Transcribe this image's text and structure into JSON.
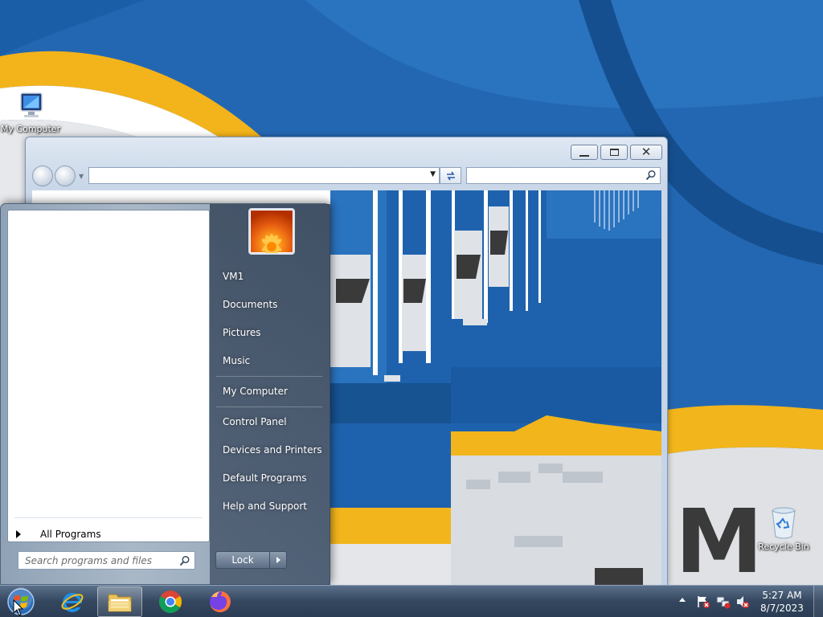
{
  "desktop": {
    "icons": [
      {
        "label": "My Computer",
        "icon": "computer-monitor-icon"
      },
      {
        "label": "Recycle Bin",
        "icon": "recycle-bin-icon"
      }
    ]
  },
  "explorer": {
    "address_value": "",
    "search_placeholder": ""
  },
  "start_menu": {
    "all_programs_label": "All Programs",
    "search_placeholder": "Search programs and files",
    "user_picture": "flower-user-picture",
    "right_items": [
      "VM1",
      "Documents",
      "Pictures",
      "Music",
      "My Computer",
      "Control Panel",
      "Devices and Printers",
      "Default Programs",
      "Help and Support"
    ],
    "lock_label": "Lock"
  },
  "taskbar": {
    "pinned": [
      "internet-explorer-icon",
      "windows-explorer-icon",
      "chrome-icon",
      "firefox-icon"
    ],
    "clock_time": "5:27 AM",
    "clock_date": "8/7/2023"
  },
  "colors": {
    "wallpaper_blue": "#1a5ea8",
    "wallpaper_yellow": "#f2b51c",
    "taskbar": "#34475f"
  }
}
